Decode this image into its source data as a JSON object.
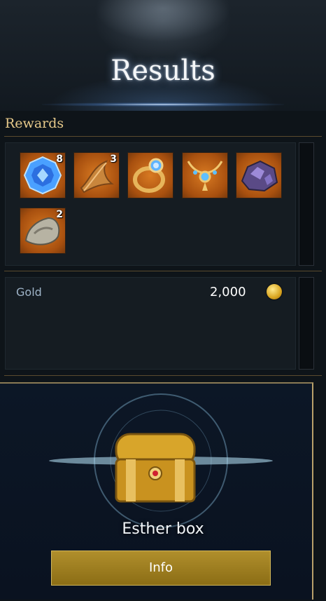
{
  "header": {
    "title": "Results"
  },
  "rewards": {
    "label": "Rewards",
    "items": [
      {
        "icon": "blue-crystal-icon",
        "quantity": "8"
      },
      {
        "icon": "feather-icon",
        "quantity": "3"
      },
      {
        "icon": "ring-icon",
        "quantity": ""
      },
      {
        "icon": "necklace-icon",
        "quantity": ""
      },
      {
        "icon": "purple-ore-icon",
        "quantity": ""
      },
      {
        "icon": "stone-icon",
        "quantity": "2"
      }
    ]
  },
  "currency": {
    "label": "Gold",
    "value": "2,000",
    "icon": "gold-coin-icon"
  },
  "chest": {
    "name": "Esther box",
    "icon": "treasure-chest-icon"
  },
  "actions": {
    "info_label": "Info"
  },
  "colors": {
    "accent_gold": "#e6c98a",
    "slot_orange": "#d87a22",
    "button_gold": "#b08f2c",
    "glow_blue": "#3caaff"
  }
}
